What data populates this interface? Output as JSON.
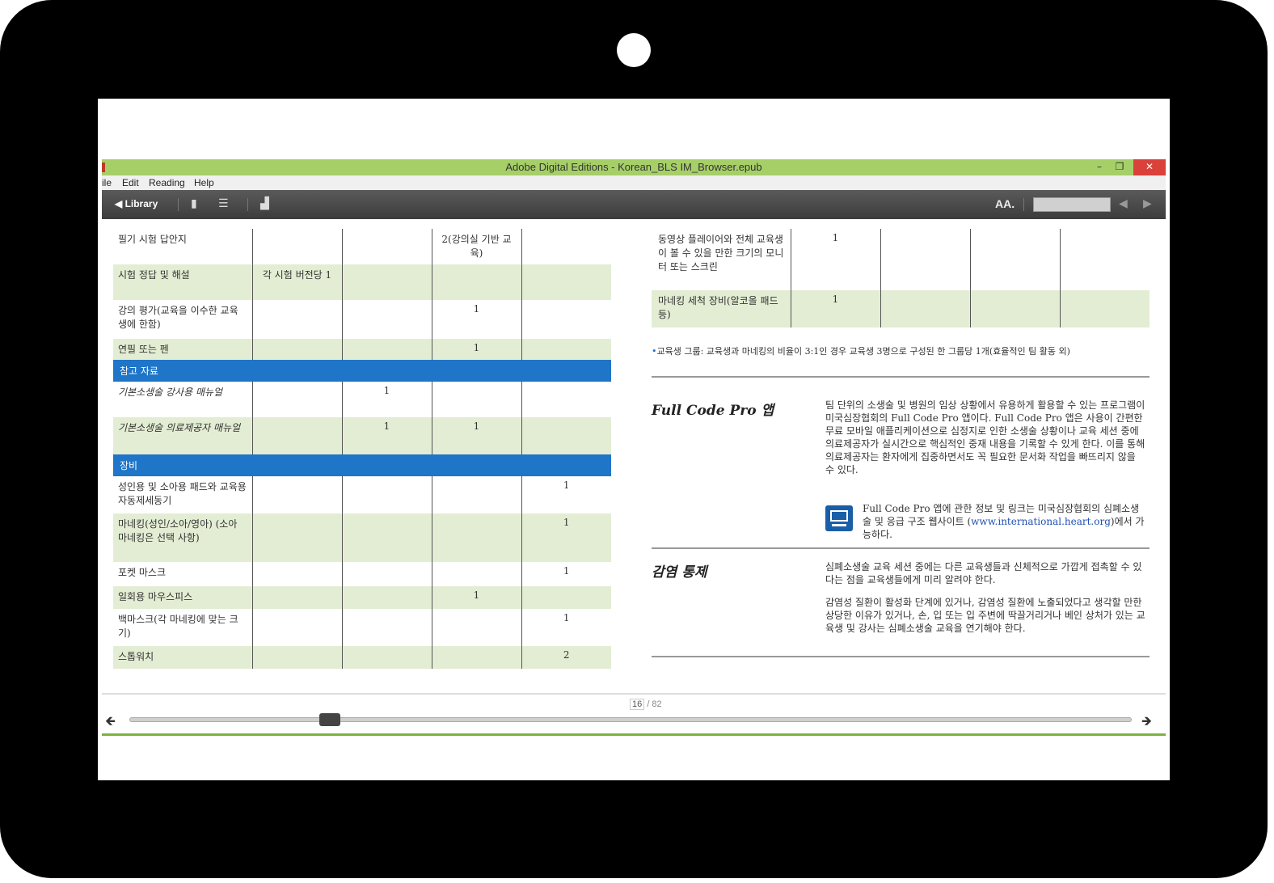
{
  "window": {
    "title": "Adobe Digital Editions - Korean_BLS IM_Browser.epub",
    "minimize": "–",
    "maximize": "❐",
    "close": "✕"
  },
  "menu": [
    "ile",
    "Edit",
    "Reading",
    "Help"
  ],
  "toolbar": {
    "library": "◀ Library",
    "bookmark_icon": "▮",
    "list_icon": "☰",
    "stats_icon": "▟",
    "font_size": "AA.",
    "prev": "◀",
    "next": "▶"
  },
  "left_table": {
    "rows": [
      {
        "type": "row",
        "alt": false,
        "cells": [
          "필기 시험 답안지",
          "",
          "",
          "2(강의실 기반 교육)",
          ""
        ]
      },
      {
        "type": "row",
        "alt": true,
        "cells": [
          "시험 정답 및 해설",
          "각 시험 버전당 1",
          "",
          "",
          ""
        ]
      },
      {
        "type": "row",
        "alt": false,
        "cells": [
          "강의 평가(교육을 이수한 교육생에 한함)",
          "",
          "",
          "1",
          ""
        ]
      },
      {
        "type": "row",
        "alt": true,
        "cells": [
          "연필 또는 펜",
          "",
          "",
          "1",
          ""
        ]
      },
      {
        "type": "section",
        "label": "참고 자료"
      },
      {
        "type": "row",
        "alt": false,
        "italic": true,
        "cells": [
          "기본소생술 강사용 매뉴얼",
          "",
          "1",
          "",
          ""
        ]
      },
      {
        "type": "row",
        "alt": true,
        "italic": true,
        "cells": [
          "기본소생술 의료제공자 매뉴얼",
          "",
          "1",
          "1",
          ""
        ]
      },
      {
        "type": "section",
        "label": "장비"
      },
      {
        "type": "row",
        "alt": false,
        "cells": [
          "성인용 및 소아용 패드와 교육용 자동제세동기",
          "",
          "",
          "",
          "1"
        ]
      },
      {
        "type": "row",
        "alt": true,
        "cells": [
          "마네킹(성인/소아/영아) (소아 마네킹은 선택 사항)",
          "",
          "",
          "",
          "1"
        ]
      },
      {
        "type": "row",
        "alt": false,
        "cells": [
          "포켓 마스크",
          "",
          "",
          "",
          "1"
        ]
      },
      {
        "type": "row",
        "alt": true,
        "cells": [
          "일회용 마우스피스",
          "",
          "",
          "1",
          ""
        ]
      },
      {
        "type": "row",
        "alt": false,
        "cells": [
          "백마스크(각 마네킹에 맞는 크기)",
          "",
          "",
          "",
          "1"
        ]
      },
      {
        "type": "row",
        "alt": true,
        "cells": [
          "스톱워치",
          "",
          "",
          "",
          "2"
        ]
      }
    ]
  },
  "right_table": {
    "rows": [
      {
        "alt": false,
        "cells": [
          "동영상 플레이어와 전체 교육생이 볼 수 있을 만한 크기의 모니터 또는 스크린",
          "1",
          "",
          "",
          ""
        ]
      },
      {
        "alt": true,
        "cells": [
          "마네킹 세척 장비(알코올 패드 등)",
          "1",
          "",
          "",
          ""
        ]
      }
    ]
  },
  "footnote": "교육생 그룹: 교육생과 마네킹의 비율이 3:1인 경우 교육생 3명으로 구성된 한 그룹당 1개(효율적인 팀 활동 외)",
  "full_code": {
    "title": "Full Code Pro 앱",
    "body": "팀 단위의 소생술 및 병원의 임상 상황에서 유용하게 활용할 수 있는 프로그램이 미국심장협회의 Full Code Pro 앱이다. Full Code Pro 앱은 사용이 간편한 무료 모바일 애플리케이션으로 심정지로 인한 소생술 상황이나 교육 세션 중에 의료제공자가 실시간으로 핵심적인 중재 내용을 기록할 수 있게 한다. 이를 통해 의료제공자는 환자에게 집중하면서도 꼭 필요한 문서화 작업을 빠뜨리지 않을 수 있다.",
    "link_before": "Full Code Pro 앱에 관한 정보 및 링크는 미국심장협회의 심폐소생술 및 응급 구조 웹사이트 (",
    "link_url": "www.international.heart.org",
    "link_after": ")에서 가능하다."
  },
  "infection": {
    "title": "감염 통제",
    "p1": "심폐소생술 교육 세션 중에는 다른 교육생들과 신체적으로 가깝게 접촉할 수 있다는 점을 교육생들에게 미리 알려야 한다.",
    "p2": "감염성 질환이 활성화 단계에 있거나, 감염성 질환에 노출되었다고 생각할 만한 상당한 이유가 있거나, 손, 입 또는 입 주변에 딱끌거리거나 베인 상처가 있는 교육생 및 강사는 심폐소생술 교육을 연기해야 한다."
  },
  "pager": {
    "current": "16",
    "total": "/ 82",
    "progress": 0.2
  },
  "nav": {
    "back": "🡸",
    "forward": "🡺"
  }
}
